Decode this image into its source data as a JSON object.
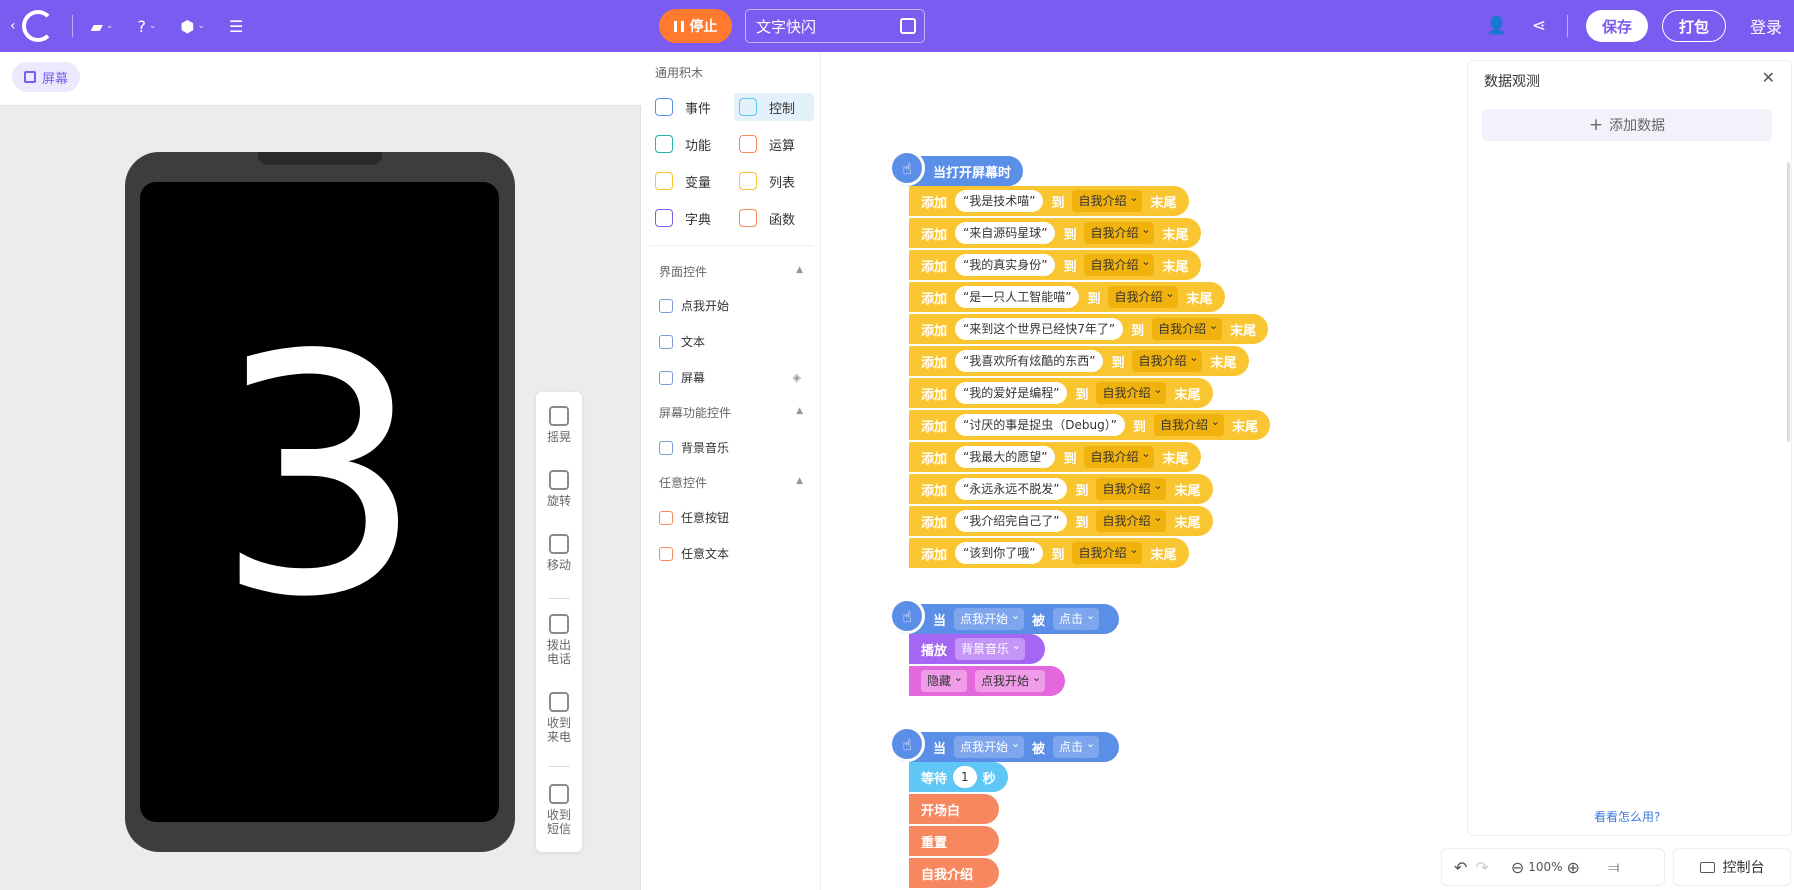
{
  "topbar": {
    "stop_label": "停止",
    "project_name": "文字快闪",
    "save_label": "保存",
    "pack_label": "打包",
    "login_label": "登录",
    "accent_color": "#7b5cf0",
    "stop_color": "#ff7a2f"
  },
  "stage": {
    "tab_label": "屏幕",
    "display_text": "3",
    "sensors": [
      {
        "label": "摇晃",
        "icon": "shake-icon"
      },
      {
        "label": "旋转",
        "icon": "rotate-icon"
      },
      {
        "label": "移动",
        "icon": "move-icon"
      },
      {
        "label": "拨出电话",
        "icon": "call-out-icon"
      },
      {
        "label": "收到来电",
        "icon": "call-in-icon"
      },
      {
        "label": "收到短信",
        "icon": "sms-icon"
      }
    ]
  },
  "palette": {
    "title": "通用积木",
    "categories": [
      {
        "label": "事件",
        "active": false,
        "color": "#5b8ee6"
      },
      {
        "label": "控制",
        "active": true,
        "color": "#5fc6f5"
      },
      {
        "label": "功能",
        "active": false,
        "color": "#2bb5a9"
      },
      {
        "label": "运算",
        "active": false,
        "color": "#f6875f"
      },
      {
        "label": "变量",
        "active": false,
        "color": "#f9c531"
      },
      {
        "label": "列表",
        "active": false,
        "color": "#f9c531"
      },
      {
        "label": "字典",
        "active": false,
        "color": "#7b5cf0"
      },
      {
        "label": "函数",
        "active": false,
        "color": "#f6875f"
      }
    ],
    "section_ui": "界面控件",
    "section_ui_items": [
      "点我开始",
      "文本",
      "屏幕"
    ],
    "section_screen": "屏幕功能控件",
    "section_screen_items": [
      "背景音乐"
    ],
    "section_any": "任意控件",
    "section_any_items": [
      "任意按钮",
      "任意文本"
    ]
  },
  "blocks": {
    "hat1": "当打开屏幕时",
    "add_word": "添加",
    "to_word": "到",
    "end_word": "末尾",
    "list_name": "自我介绍",
    "strings": [
      "我是技术喵",
      "来自源码星球",
      "我的真实身份",
      "是一只人工智能喵",
      "来到这个世界已经快7年了",
      "我喜欢所有炫酷的东西",
      "我的爱好是编程",
      "讨厌的事是捉虫（Debug）",
      "我最大的愿望",
      "永远永远不脱发",
      "我介绍完自己了",
      "该到你了哦"
    ],
    "hat_when": "当",
    "hat_target": "点我开始",
    "hat_was": "被",
    "hat_event": "点击",
    "play_word": "播放",
    "play_target": "背景音乐",
    "hide_word": "隐藏",
    "hide_target": "点我开始",
    "wait_word": "等待",
    "wait_value": "1",
    "wait_unit": "秒",
    "call1": "开场白",
    "call2": "重置",
    "call3": "自我介绍"
  },
  "watch": {
    "title": "数据观测",
    "add_label": "添加数据",
    "help_link": "看看怎么用?"
  },
  "bottom": {
    "zoom": "100%",
    "console_label": "控制台"
  }
}
